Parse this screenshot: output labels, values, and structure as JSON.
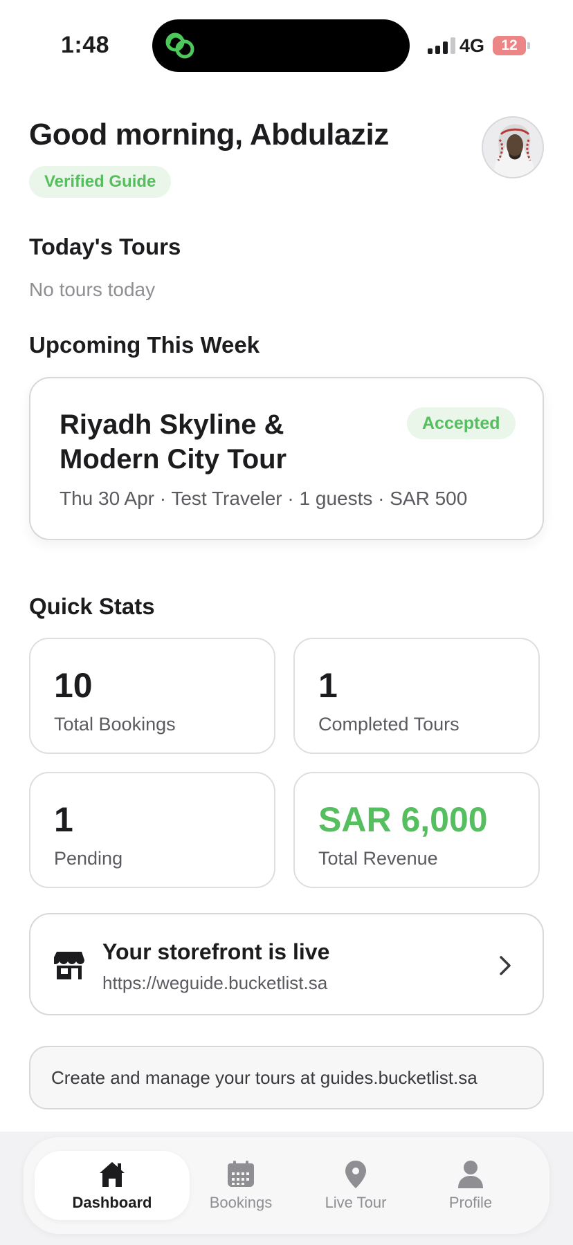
{
  "status_bar": {
    "time": "1:48",
    "network": "4G",
    "battery": "12"
  },
  "header": {
    "greeting": "Good morning, Abdulaziz",
    "badge": "Verified Guide"
  },
  "todays_tours": {
    "title": "Today's Tours",
    "empty_text": "No tours today"
  },
  "upcoming": {
    "title": "Upcoming This Week",
    "cards": [
      {
        "title": "Riyadh Skyline & Modern City Tour",
        "status": "Accepted",
        "meta": "Thu 30 Apr · Test Traveler · 1 guests · SAR 500"
      }
    ]
  },
  "quick_stats": {
    "title": "Quick Stats",
    "items": [
      {
        "value": "10",
        "label": "Total Bookings"
      },
      {
        "value": "1",
        "label": "Completed Tours"
      },
      {
        "value": "1",
        "label": "Pending"
      },
      {
        "value": "SAR 6,000",
        "label": "Total Revenue"
      }
    ]
  },
  "storefront": {
    "title": "Your storefront is live",
    "url": "https://weguide.bucketlist.sa"
  },
  "info": {
    "text": "Create and manage your tours at guides.bucketlist.sa"
  },
  "tabs": [
    {
      "label": "Dashboard",
      "icon": "home-icon",
      "active": true
    },
    {
      "label": "Bookings",
      "icon": "calendar-icon",
      "active": false
    },
    {
      "label": "Live Tour",
      "icon": "map-pin-icon",
      "active": false
    },
    {
      "label": "Profile",
      "icon": "person-icon",
      "active": false
    }
  ],
  "colors": {
    "accent_green": "#55be5e",
    "badge_bg": "#eaf6ea"
  }
}
